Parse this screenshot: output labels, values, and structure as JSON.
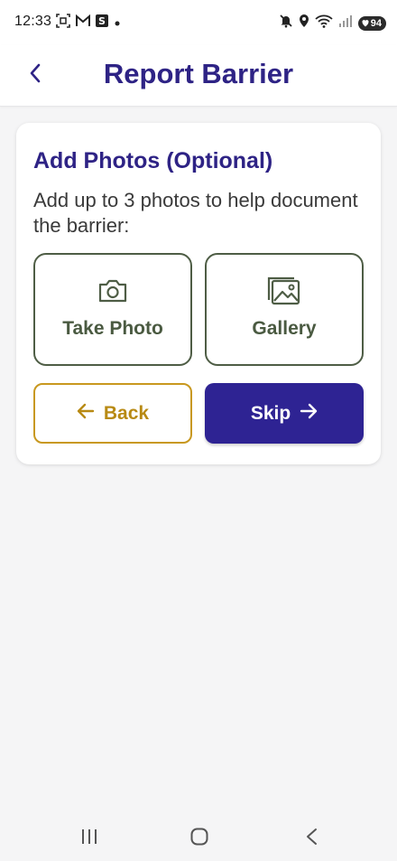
{
  "status_bar": {
    "time": "12:33",
    "battery": "94",
    "left_icons": [
      "screenshot-icon",
      "gmail-icon",
      "s-app-icon",
      "dot-icon"
    ],
    "right_icons": [
      "mute-icon",
      "location-icon",
      "wifi-icon",
      "signal-icon",
      "battery-icon"
    ]
  },
  "header": {
    "title": "Report Barrier",
    "back_icon": "chevron-left-icon"
  },
  "card": {
    "title": "Add Photos (Optional)",
    "description": "Add up to 3 photos to help document the barrier:",
    "take_photo_label": "Take Photo",
    "take_photo_icon": "camera-icon",
    "gallery_label": "Gallery",
    "gallery_icon": "image-gallery-icon",
    "back_label": "Back",
    "back_icon": "arrow-left-icon",
    "skip_label": "Skip",
    "skip_icon": "arrow-right-icon"
  },
  "colors": {
    "primary": "#2e2393",
    "title": "#2e2385",
    "accent_gold": "#c8981f",
    "olive": "#4e5d45",
    "background": "#f5f5f6"
  },
  "system_nav": {
    "icons": [
      "recent-apps-icon",
      "home-icon",
      "back-nav-icon"
    ]
  }
}
